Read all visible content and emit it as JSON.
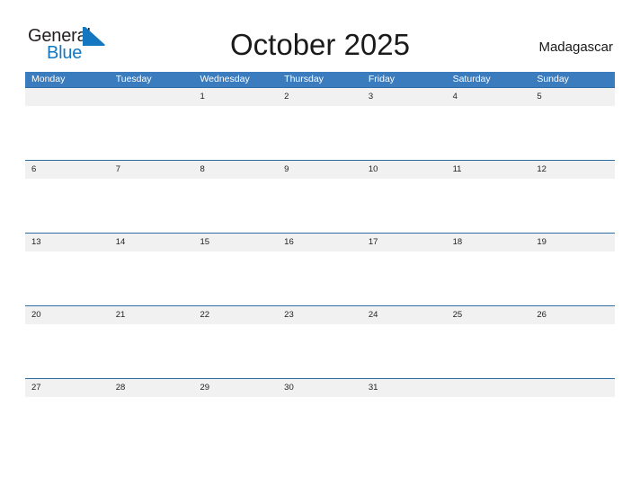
{
  "brand": {
    "name_part1": "General",
    "name_part2": "Blue",
    "flag_icon": "triangle-flag-icon",
    "color_dark": "#231f20",
    "color_blue": "#1577c0"
  },
  "header": {
    "title": "October 2025",
    "region": "Madagascar"
  },
  "calendar": {
    "month": "October",
    "year": "2025",
    "header_bg": "#3b7cbe",
    "rule_color": "#2e6da4",
    "band_bg": "#f1f1f1",
    "weekdays": [
      "Monday",
      "Tuesday",
      "Wednesday",
      "Thursday",
      "Friday",
      "Saturday",
      "Sunday"
    ],
    "weeks": [
      [
        "",
        "",
        "1",
        "2",
        "3",
        "4",
        "5"
      ],
      [
        "6",
        "7",
        "8",
        "9",
        "10",
        "11",
        "12"
      ],
      [
        "13",
        "14",
        "15",
        "16",
        "17",
        "18",
        "19"
      ],
      [
        "20",
        "21",
        "22",
        "23",
        "24",
        "25",
        "26"
      ],
      [
        "27",
        "28",
        "29",
        "30",
        "31",
        "",
        ""
      ]
    ]
  }
}
